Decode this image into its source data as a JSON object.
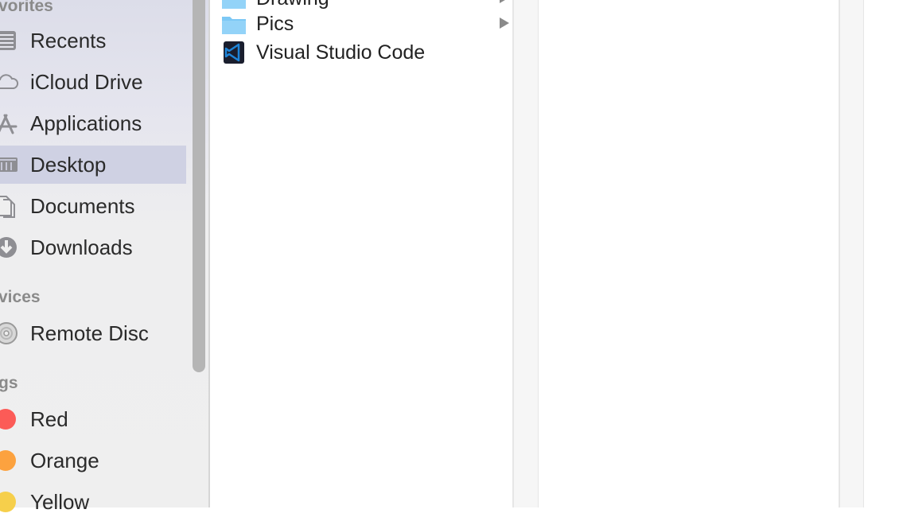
{
  "sidebar": {
    "favorites_header": "vorites",
    "devices_header": "vices",
    "tags_header": "gs",
    "favorites": [
      {
        "label": "Recents",
        "icon": "recents-icon"
      },
      {
        "label": "iCloud Drive",
        "icon": "cloud-icon"
      },
      {
        "label": "Applications",
        "icon": "applications-icon"
      },
      {
        "label": "Desktop",
        "icon": "desktop-icon",
        "selected": true
      },
      {
        "label": "Documents",
        "icon": "documents-icon"
      },
      {
        "label": "Downloads",
        "icon": "downloads-icon"
      }
    ],
    "devices": [
      {
        "label": "Remote Disc",
        "icon": "disc-icon"
      }
    ],
    "tags": [
      {
        "label": "Red",
        "color": "#fc5b57"
      },
      {
        "label": "Orange",
        "color": "#fca23f"
      },
      {
        "label": "Yellow",
        "color": "#f6cf4b"
      }
    ]
  },
  "column1": {
    "items": [
      {
        "name": "Drawing",
        "type": "folder",
        "has_children": true
      },
      {
        "name": "Pics",
        "type": "folder",
        "has_children": true
      },
      {
        "name": "Visual Studio Code",
        "type": "application",
        "has_children": false
      }
    ]
  },
  "colors": {
    "folder": "#7cc8f5",
    "selection": "#cfd1e3",
    "vscode": "#1e84d8"
  }
}
